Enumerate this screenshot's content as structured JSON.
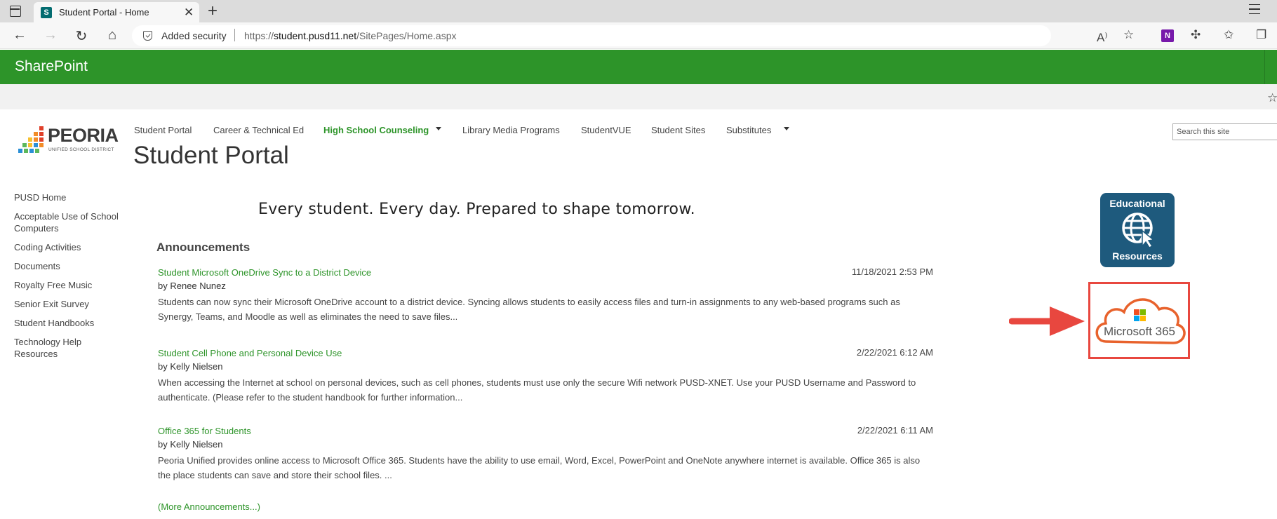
{
  "browser": {
    "tab_title": "Student Portal - Home",
    "security_label": "Added security",
    "url_prefix": "https://",
    "url_domain": "student.pusd11.net",
    "url_path": "/SitePages/Home.aspx",
    "icons": [
      "sidebar-icon",
      "back-icon",
      "forward-icon",
      "refresh-icon",
      "home-icon",
      "lock-icon",
      "read-aloud-icon",
      "favorite-add-icon",
      "onenote-icon",
      "extensions-icon",
      "favorites-icon",
      "collections-icon",
      "menu-icon"
    ]
  },
  "suite": {
    "title": "SharePoint",
    "brand_color": "#2d9429"
  },
  "header": {
    "logo_text": "PEORIA",
    "logo_subtext": "UNIFIED SCHOOL DISTRICT",
    "site_title": "Student Portal",
    "search_placeholder": "Search this site"
  },
  "topnav": {
    "items": [
      {
        "label": "Student Portal"
      },
      {
        "label": "Career & Technical Ed"
      },
      {
        "label": "High School Counseling",
        "active": true,
        "dropdown": true
      },
      {
        "label": "Library Media Programs"
      },
      {
        "label": "StudentVUE"
      },
      {
        "label": "Student Sites"
      },
      {
        "label": "Substitutes",
        "dropdown": true
      }
    ]
  },
  "leftnav": {
    "items": [
      {
        "label": "PUSD Home"
      },
      {
        "label": "Acceptable Use of School Computers"
      },
      {
        "label": "Coding Activities"
      },
      {
        "label": "Documents"
      },
      {
        "label": "Royalty Free Music"
      },
      {
        "label": "Senior Exit Survey"
      },
      {
        "label": "Student Handbooks"
      },
      {
        "label": "Technology Help Resources"
      }
    ]
  },
  "main": {
    "tagline": "Every student. Every day. Prepared to shape tomorrow.",
    "announcements_heading": "Announcements",
    "announcements": [
      {
        "title": "Student Microsoft OneDrive Sync to a District Device",
        "date": "11/18/2021 2:53 PM",
        "author": "by Renee Nunez",
        "body": "Students can now sync their Microsoft OneDrive account to a district device. Syncing allows students to easily access files and turn-in assignments to any web-based programs such as Synergy, Teams, and Moodle as well as eliminates the need to save files..."
      },
      {
        "title": "Student Cell Phone and Personal Device Use",
        "date": "2/22/2021 6:12 AM",
        "author": "by Kelly Nielsen",
        "body": "When accessing the Internet at school on personal devices, such as cell phones, students must use only the secure Wifi network PUSD-XNET. Use your PUSD Username and Password to authenticate. (Please refer to the student handbook for further information..."
      },
      {
        "title": "Office 365 for Students",
        "date": "2/22/2021 6:11 AM",
        "author": "by Kelly Nielsen",
        "body": "Peoria Unified provides online access to Microsoft Office 365. Students have the ability to use email, Word, Excel, PowerPoint and OneNote anywhere internet is available. Office 365 is also the place students can save and store their school files. ..."
      }
    ],
    "more_link": "(More Announcements...)"
  },
  "sidebar_tiles": {
    "edu_top": "Educational",
    "edu_bottom": "Resources",
    "edu_color": "#1e5a7d",
    "ms365_label": "Microsoft 365",
    "highlight_color": "#e8473f"
  }
}
